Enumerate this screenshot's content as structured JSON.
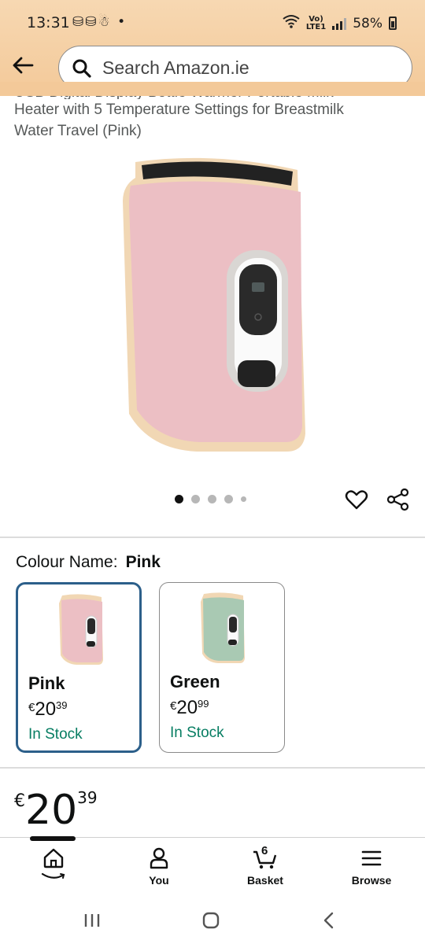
{
  "status_bar": {
    "time": "13:31",
    "battery": "58%",
    "network": "LTE1"
  },
  "header": {
    "search_placeholder": "Search Amazon.ie"
  },
  "product": {
    "title_clipped": "USB Digital Display Bottle Warmer Portable Milk",
    "title_line2": "Heater with 5 Temperature Settings for Breastmilk",
    "title_line3": "Water Travel (Pink)"
  },
  "carousel": {
    "count": 5,
    "active_index": 0
  },
  "variation": {
    "label": "Colour Name:",
    "selected": "Pink",
    "options": [
      {
        "name": "Pink",
        "currency": "€",
        "whole": "20",
        "fraction": "39",
        "stock": "In Stock",
        "color": "#ecc0c4"
      },
      {
        "name": "Green",
        "currency": "€",
        "whole": "20",
        "fraction": "99",
        "stock": "In Stock",
        "color": "#a9c9b3"
      }
    ]
  },
  "price": {
    "currency": "€",
    "whole": "20",
    "fraction": "39"
  },
  "bottom_nav": {
    "home": "",
    "you": "You",
    "basket": "Basket",
    "basket_count": "6",
    "browse": "Browse"
  },
  "colors": {
    "header": "#f3c999",
    "stock": "#067d62",
    "selected_border": "#2c5f8a"
  }
}
